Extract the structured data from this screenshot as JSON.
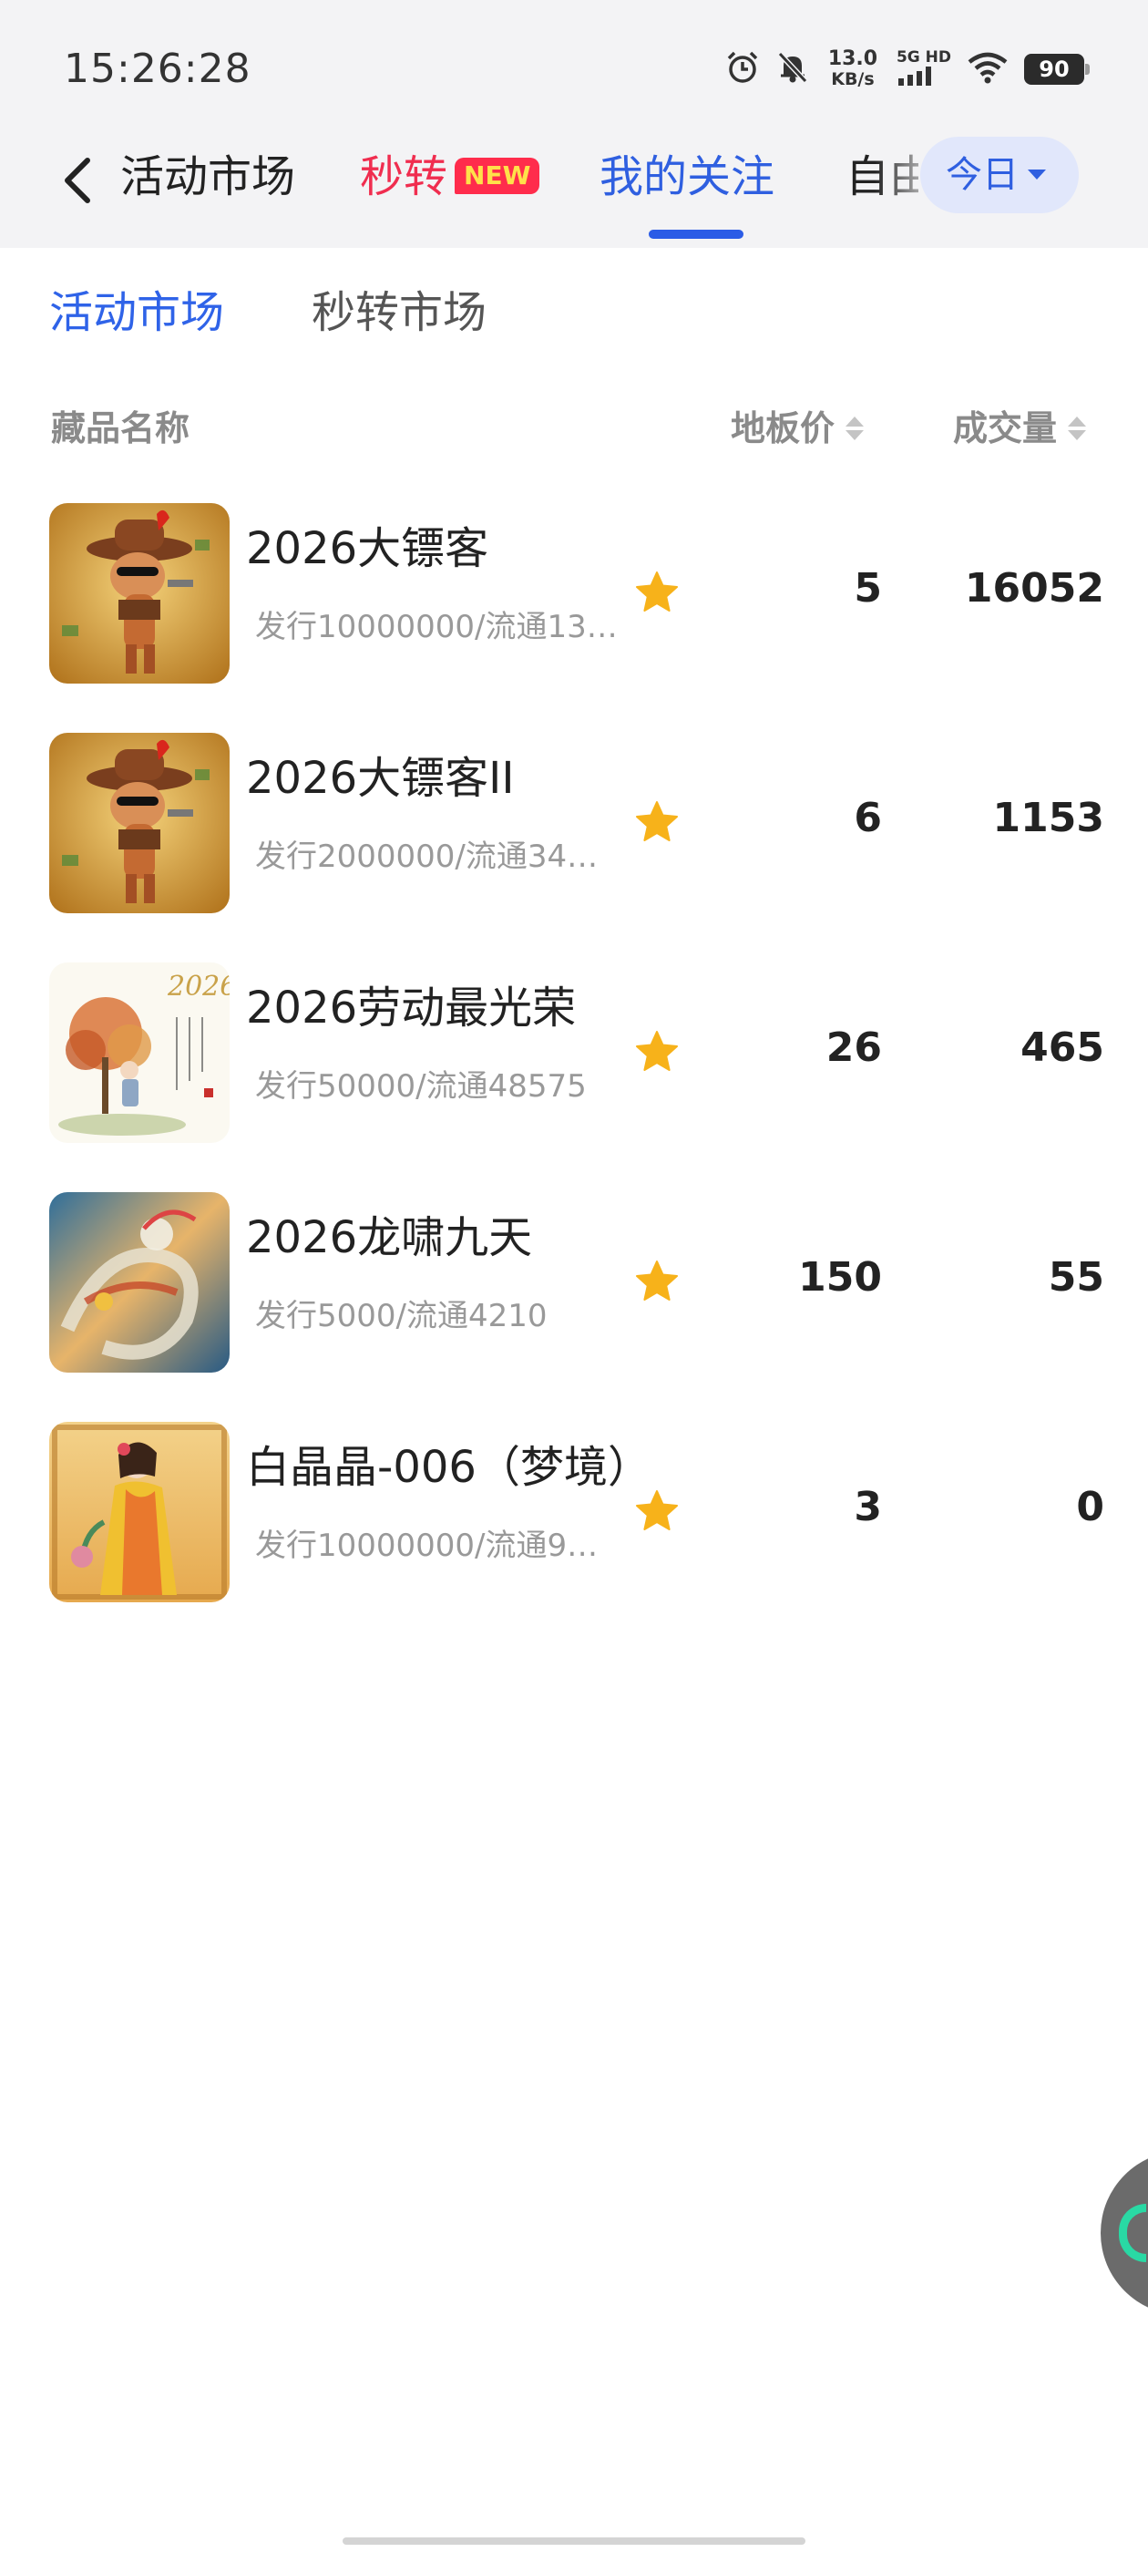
{
  "status_bar": {
    "time": "15:26:28",
    "net_speed_value": "13.0",
    "net_speed_unit": "KB/s",
    "network_type": "5G HD",
    "battery": "90",
    "icons": [
      "alarm-icon",
      "mute-icon",
      "signal-icon",
      "wifi-icon",
      "battery-icon"
    ]
  },
  "tabs": {
    "activity": "活动市场",
    "second": "秒转",
    "second_badge": "NEW",
    "follow": "我的关注",
    "self_partial": "自由",
    "today_button": "今日"
  },
  "sub_tabs": {
    "activity": "活动市场",
    "second": "秒转市场"
  },
  "table_header": {
    "name": "藏品名称",
    "floor_price": "地板价",
    "volume": "成交量"
  },
  "items": [
    {
      "title": "2026大镖客",
      "subtitle": "发行10000000/流通13…",
      "price": "5",
      "volume": "16052",
      "starred": true
    },
    {
      "title": "2026大镖客II",
      "subtitle": "发行2000000/流通34…",
      "price": "6",
      "volume": "1153",
      "starred": true
    },
    {
      "title": "2026劳动最光荣",
      "subtitle": "发行50000/流通48575",
      "price": "26",
      "volume": "465",
      "starred": true
    },
    {
      "title": "2026龙啸九天",
      "subtitle": "发行5000/流通4210",
      "price": "150",
      "volume": "55",
      "starred": true
    },
    {
      "title": "白晶晶-006（梦境）",
      "subtitle": "发行10000000/流通9…",
      "price": "3",
      "volume": "0",
      "starred": true
    }
  ],
  "colors": {
    "accent_blue": "#2f5fe0",
    "accent_red": "#f02d4f",
    "star_yellow": "#f7b21a"
  }
}
